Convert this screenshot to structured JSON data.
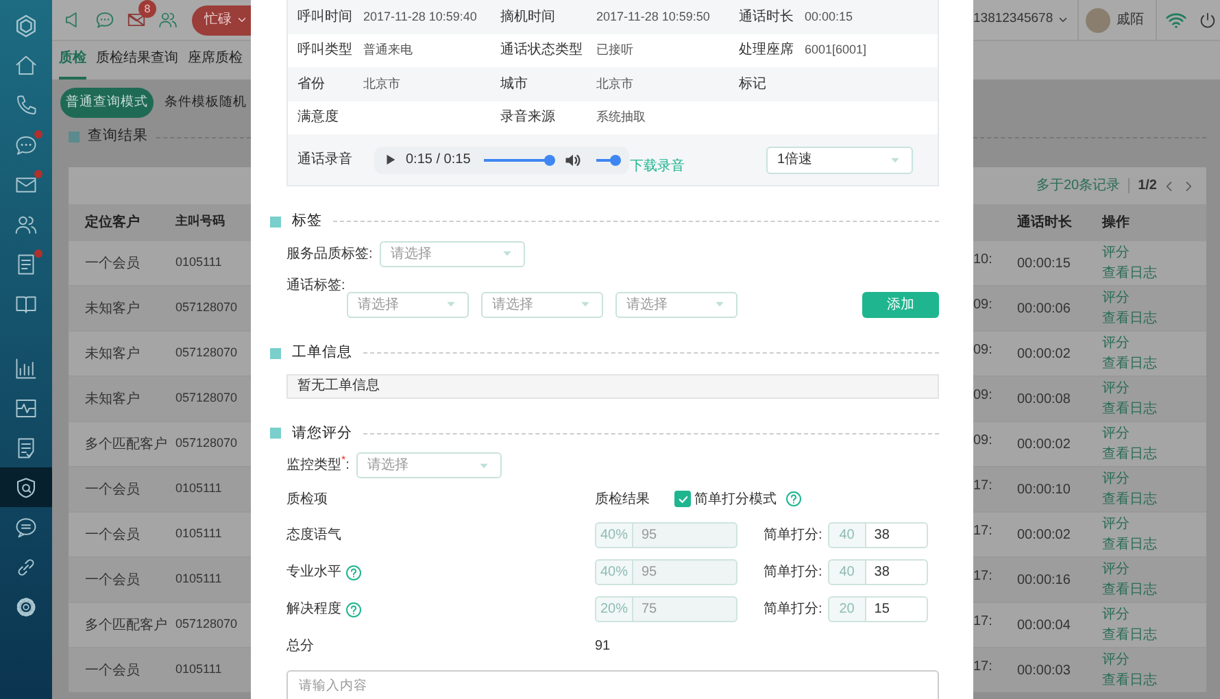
{
  "sidebar": {
    "top_items": [
      {
        "kind": "logo",
        "selected": false,
        "dot": false
      },
      {
        "kind": "home",
        "selected": false,
        "dot": false
      },
      {
        "kind": "phone",
        "selected": false,
        "dot": false
      },
      {
        "kind": "chat",
        "selected": false,
        "dot": true
      },
      {
        "kind": "mail",
        "selected": false,
        "dot": true
      },
      {
        "kind": "users",
        "selected": false,
        "dot": false
      },
      {
        "kind": "document",
        "selected": false,
        "dot": true
      },
      {
        "kind": "book",
        "selected": false,
        "dot": false
      }
    ],
    "bottom_items": [
      {
        "kind": "bars",
        "selected": false,
        "dot": false
      },
      {
        "kind": "pulse",
        "selected": false,
        "dot": false
      },
      {
        "kind": "checklist",
        "selected": false,
        "dot": false
      },
      {
        "kind": "shield",
        "selected": true,
        "dot": false
      },
      {
        "kind": "comment",
        "selected": false,
        "dot": false
      },
      {
        "kind": "link",
        "selected": false,
        "dot": false
      },
      {
        "kind": "gear",
        "selected": false,
        "dot": false
      }
    ]
  },
  "topbar": {
    "mail_badge": "8",
    "status": "忙碌",
    "phone": "13812345678",
    "user": "戚陌"
  },
  "tabs": [
    {
      "label": "质检",
      "selected": true
    },
    {
      "label": "质检结果查询",
      "selected": false
    },
    {
      "label": "座席质检",
      "selected": false
    }
  ],
  "modes": [
    {
      "label": "普通查询模式",
      "selected": true
    },
    {
      "label": "条件模板随机",
      "selected": false
    }
  ],
  "results": {
    "title": "查询结果",
    "summary": "多于20条记录",
    "page": "1/2",
    "columns": [
      "定位客户",
      "主叫号码",
      "通话时长",
      "操作"
    ],
    "rows": [
      {
        "customer": "一个会员",
        "caller": "0105111",
        "column_3": "10:",
        "duration": "00:00:15",
        "actions": [
          "评分",
          "查看日志"
        ]
      },
      {
        "customer": "未知客户",
        "caller": "057128070",
        "column_3": "09:",
        "duration": "00:00:06",
        "actions": [
          "评分",
          "查看日志"
        ]
      },
      {
        "customer": "未知客户",
        "caller": "057128070",
        "column_3": "09:",
        "duration": "00:00:02",
        "actions": [
          "评分",
          "查看日志"
        ]
      },
      {
        "customer": "未知客户",
        "caller": "057128070",
        "column_3": "09:",
        "duration": "00:00:08",
        "actions": [
          "评分",
          "查看日志"
        ]
      },
      {
        "customer": "多个匹配客户",
        "caller": "057128070",
        "column_3": "09:",
        "duration": "00:00:02",
        "actions": [
          "评分",
          "查看日志"
        ]
      },
      {
        "customer": "一个会员",
        "caller": "0105111",
        "column_3": "17:",
        "duration": "00:00:10",
        "actions": [
          "评分",
          "查看日志"
        ]
      },
      {
        "customer": "一个会员",
        "caller": "0105111",
        "column_3": "17:",
        "duration": "00:00:02",
        "actions": [
          "评分",
          "查看日志"
        ]
      },
      {
        "customer": "一个会员",
        "caller": "0105111",
        "column_3": "17:",
        "duration": "00:00:16",
        "actions": [
          "评分",
          "查看日志"
        ]
      },
      {
        "customer": "多个匹配客户",
        "caller": "057128070",
        "column_3": "17:",
        "duration": "00:00:04",
        "actions": [
          "评分",
          "查看日志"
        ]
      },
      {
        "customer": "一个会员",
        "caller": "0105111",
        "column_3": "17:",
        "duration": "00:00:03",
        "actions": [
          "评分",
          "查看日志"
        ]
      }
    ]
  },
  "call_info": {
    "rows": [
      [
        {
          "label": "呼叫时间",
          "value": "2017-11-28 10:59:40"
        },
        {
          "label": "摘机时间",
          "value": "2017-11-28 10:59:50"
        },
        {
          "label": "通话时长",
          "value": "00:00:15"
        }
      ],
      [
        {
          "label": "呼叫类型",
          "value": "普通来电"
        },
        {
          "label": "通话状态类型",
          "value": "已接听"
        },
        {
          "label": "处理座席",
          "value": "6001[6001]"
        }
      ],
      [
        {
          "label": "省份",
          "value": "北京市"
        },
        {
          "label": "城市",
          "value": "北京市"
        },
        {
          "label": "标记"
        }
      ],
      [
        {
          "label": "满意度"
        },
        {
          "label": "录音来源",
          "value": "系统抽取"
        }
      ]
    ]
  },
  "recording": {
    "label": "通话录音",
    "time": "0:15 / 0:15",
    "progress": {
      "level": 1.0
    },
    "volume": {
      "level": 1.0
    },
    "download": "下载录音",
    "speed": {
      "value": "1倍速"
    }
  },
  "tags": {
    "title": "标签",
    "service_label": "服务品质标签:",
    "service_select": {
      "placeholder": "请选择"
    },
    "call_label": "通话标签:",
    "call_selects": [
      {
        "placeholder": "请选择"
      },
      {
        "placeholder": "请选择"
      },
      {
        "placeholder": "请选择"
      }
    ],
    "add_button": "添加"
  },
  "work_order": {
    "title": "工单信息",
    "text": "暂无工单信息"
  },
  "rating": {
    "title": "请您评分",
    "monitor_label": "监控类型$^{*}$:",
    "monitor_select": {
      "placeholder": "请选择"
    },
    "item_header": "质检项",
    "result_header": "质检结果",
    "simple_mode": {
      "label": "简单打分模式",
      "checked": true,
      "help": true
    },
    "items": [
      {
        "name": "态度语气",
        "help": false,
        "weight": "40%",
        "score": "95",
        "simple_label": "简单打分:",
        "max": "40",
        "value": "38"
      },
      {
        "name": "专业水平",
        "help": true,
        "weight": "40%",
        "score": "95",
        "simple_label": "简单打分:",
        "max": "40",
        "value": "38"
      },
      {
        "name": "解决程度",
        "help": true,
        "weight": "20%",
        "score": "75",
        "simple_label": "简单打分:",
        "max": "20",
        "value": "15"
      }
    ],
    "total_label": "总分",
    "total": "91",
    "comment": {
      "placeholder": "请输入内容"
    }
  }
}
